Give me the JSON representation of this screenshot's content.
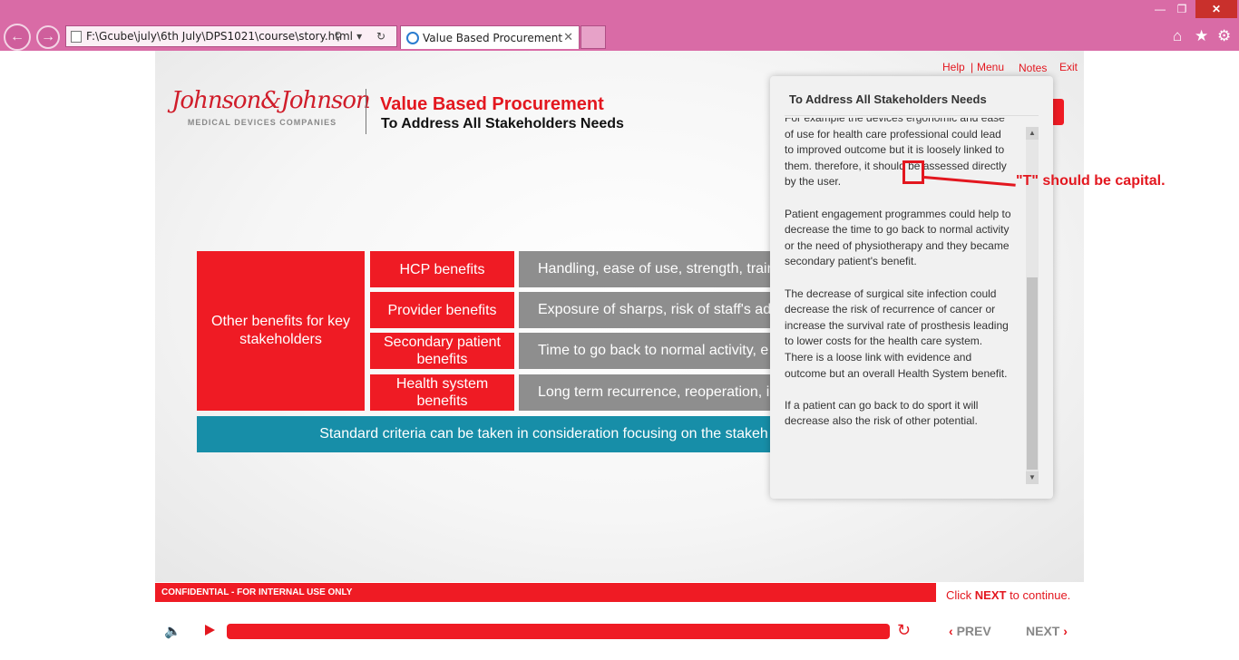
{
  "browser": {
    "address": "F:\\Gcube\\july\\6th July\\DPS1021\\course\\story.html",
    "tab_title": "Value Based Procurement",
    "address_tools": "⚲ ▾ ↻"
  },
  "header": {
    "logo_script": "Johnson&Johnson",
    "logo_sub": "MEDICAL DEVICES COMPANIES",
    "title": "Value Based Procurement",
    "subtitle": "To Address All Stakeholders Needs"
  },
  "toplinks": {
    "help": "Help",
    "menu": "Menu",
    "notes": "Notes",
    "exit": "Exit",
    "sep": "|"
  },
  "grid": {
    "main_label": "Other benefits for key stakeholders",
    "rows": [
      {
        "label": "HCP benefits",
        "detail": "Handling, ease of use, strength, traini"
      },
      {
        "label": "Provider benefits",
        "detail": "Exposure of sharps, risk of staff's adv"
      },
      {
        "label": "Secondary patient benefits",
        "detail": "Time to go back to normal activity, e"
      },
      {
        "label": "Health system benefits",
        "detail": "Long term recurrence, reoperation, in"
      }
    ],
    "standard": "Standard criteria can be taken in consideration focusing on the stakeh"
  },
  "notes": {
    "heading": "To Address All Stakeholders Needs",
    "paragraphs": [
      "For example the devices ergonomic and ease of use for health care professional could lead to improved outcome but it is loosely linked to them. therefore, it should be assessed directly by the user.",
      "Patient engagement programmes could help to decrease the time to go back to normal activity or the need of physiotherapy and they became secondary patient's benefit.",
      "The decrease of surgical site infection could decrease the risk of recurrence of cancer or increase the survival rate of prosthesis leading to lower costs for the health care system. There is a loose link with evidence and outcome but an overall Health System benefit.",
      "If a patient can go back to do sport it will decrease also the risk of other potential."
    ]
  },
  "annotation": {
    "text": "\"T\" should be capital."
  },
  "footer": {
    "confidential": "CONFIDENTIAL - FOR INTERNAL USE ONLY",
    "click_pre": "Click ",
    "click_next": "NEXT",
    "click_post": " to continue.",
    "prev": "PREV",
    "next": "NEXT"
  },
  "colors": {
    "brand_red": "#ef1b24",
    "teal": "#178ea8",
    "gray": "#8e8e8e",
    "chrome": "#d96ba6"
  }
}
